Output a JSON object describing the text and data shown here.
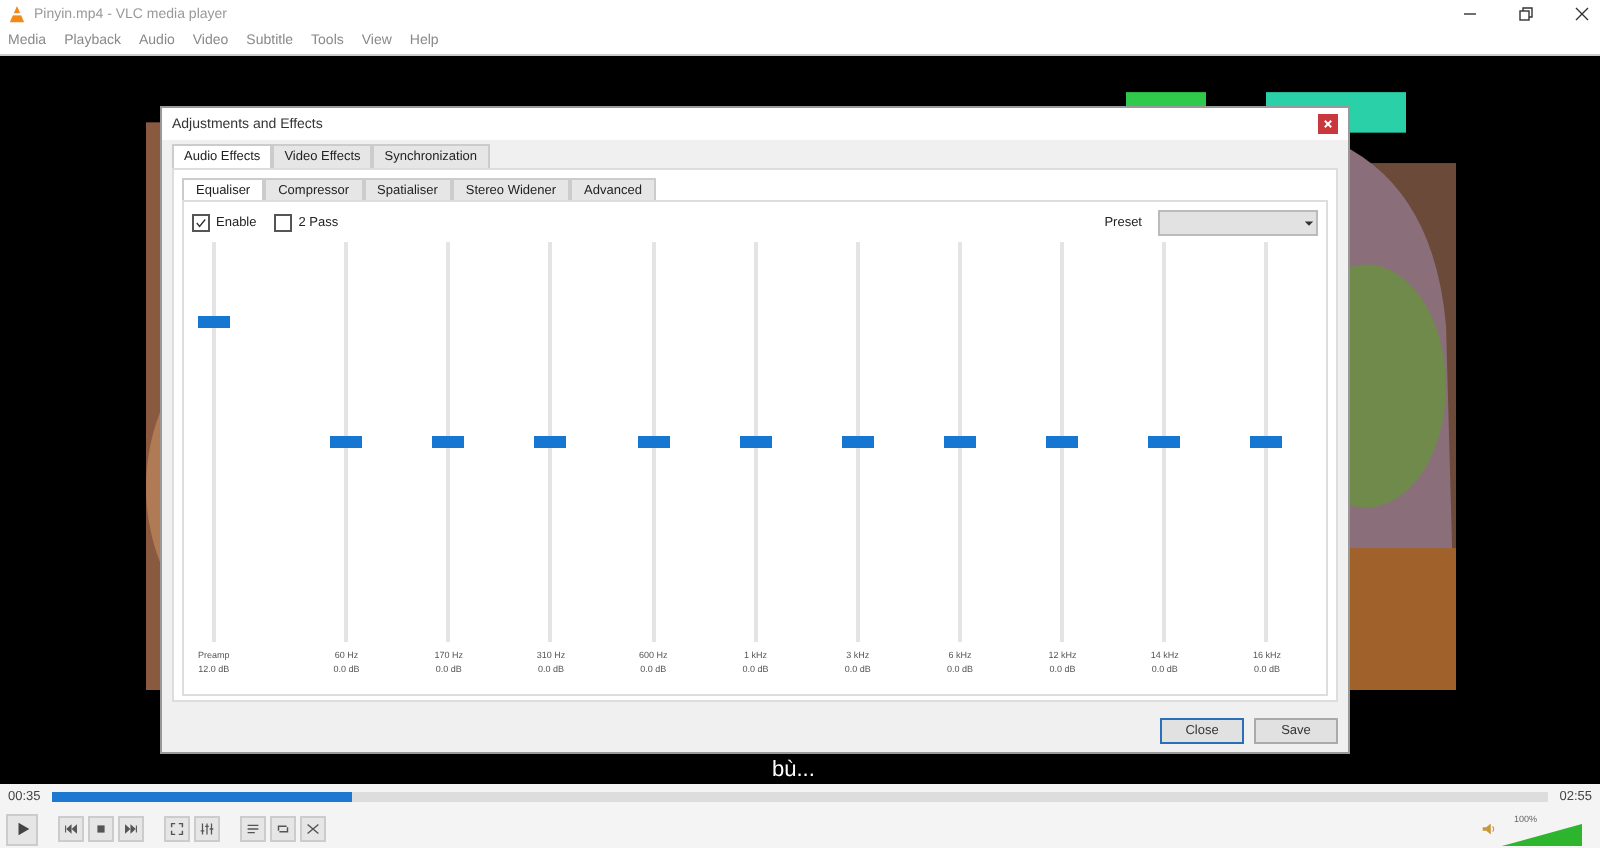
{
  "window": {
    "title": "Pinyin.mp4 - VLC media player"
  },
  "menu": [
    "Media",
    "Playback",
    "Audio",
    "Video",
    "Subtitle",
    "Tools",
    "View",
    "Help"
  ],
  "video": {
    "kind": "picture",
    "subtitle": "bù..."
  },
  "dialog": {
    "title": "Adjustments and Effects",
    "tabs": [
      {
        "label": "Audio Effects",
        "selected": true
      },
      {
        "label": "Video Effects",
        "selected": false
      },
      {
        "label": "Synchronization",
        "selected": false
      }
    ],
    "subtabs": [
      {
        "label": "Equaliser",
        "selected": true
      },
      {
        "label": "Compressor",
        "selected": false
      },
      {
        "label": "Spatialiser",
        "selected": false
      },
      {
        "label": "Stereo Widener",
        "selected": false
      },
      {
        "label": "Advanced",
        "selected": false
      }
    ],
    "enable": {
      "label": "Enable",
      "checked": true
    },
    "two_pass": {
      "label": "2 Pass",
      "checked": false
    },
    "preset": {
      "label": "Preset"
    },
    "preamp": {
      "label": "Preamp",
      "reading": "12.0 dB",
      "level": 0.8
    },
    "bands": [
      {
        "label": "60 Hz",
        "reading": "0.0 dB",
        "level": 0.5
      },
      {
        "label": "170 Hz",
        "reading": "0.0 dB",
        "level": 0.5
      },
      {
        "label": "310 Hz",
        "reading": "0.0 dB",
        "level": 0.5
      },
      {
        "label": "600 Hz",
        "reading": "0.0 dB",
        "level": 0.5
      },
      {
        "label": "1 kHz",
        "reading": "0.0 dB",
        "level": 0.5
      },
      {
        "label": "3 kHz",
        "reading": "0.0 dB",
        "level": 0.5
      },
      {
        "label": "6 kHz",
        "reading": "0.0 dB",
        "level": 0.5
      },
      {
        "label": "12 kHz",
        "reading": "0.0 dB",
        "level": 0.5
      },
      {
        "label": "14 kHz",
        "reading": "0.0 dB",
        "level": 0.5
      },
      {
        "label": "16 kHz",
        "reading": "0.0 dB",
        "level": 0.5
      }
    ],
    "buttons": [
      "Close",
      "Save"
    ]
  },
  "playback": {
    "elapsed": "00:35",
    "total": "02:55",
    "level": 0.2
  },
  "volume": {
    "label": "100%",
    "level": 1
  }
}
